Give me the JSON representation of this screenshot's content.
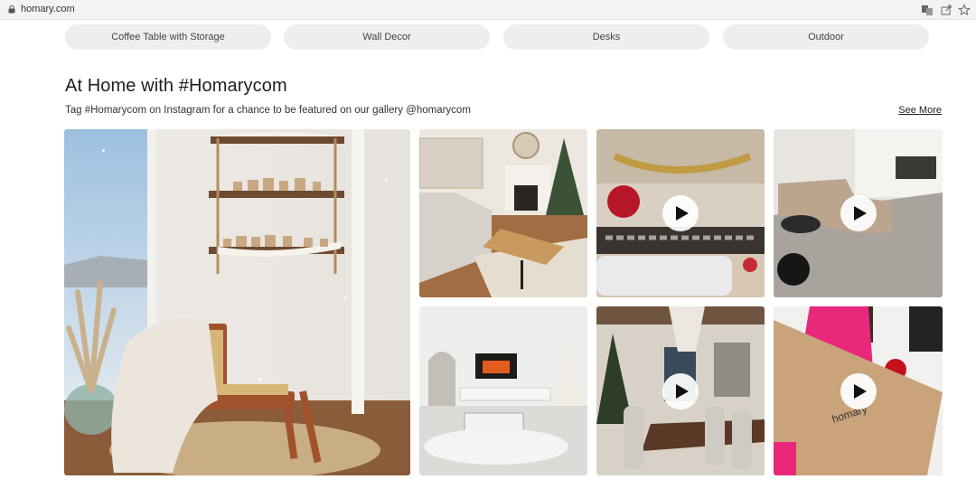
{
  "browser": {
    "url": "homary.com"
  },
  "categories": [
    "Coffee Table with Storage",
    "Wall Decor",
    "Desks",
    "Outdoor"
  ],
  "gallery": {
    "title": "At Home with #Homarycom",
    "subtitle": "Tag #Homarycom on Instagram for a chance to be featured on our gallery @homarycom",
    "see_more": "See More",
    "box_brand": "homary"
  },
  "icons": [
    "lock-icon",
    "translate-icon",
    "share-icon",
    "star-icon",
    "play-icon"
  ]
}
